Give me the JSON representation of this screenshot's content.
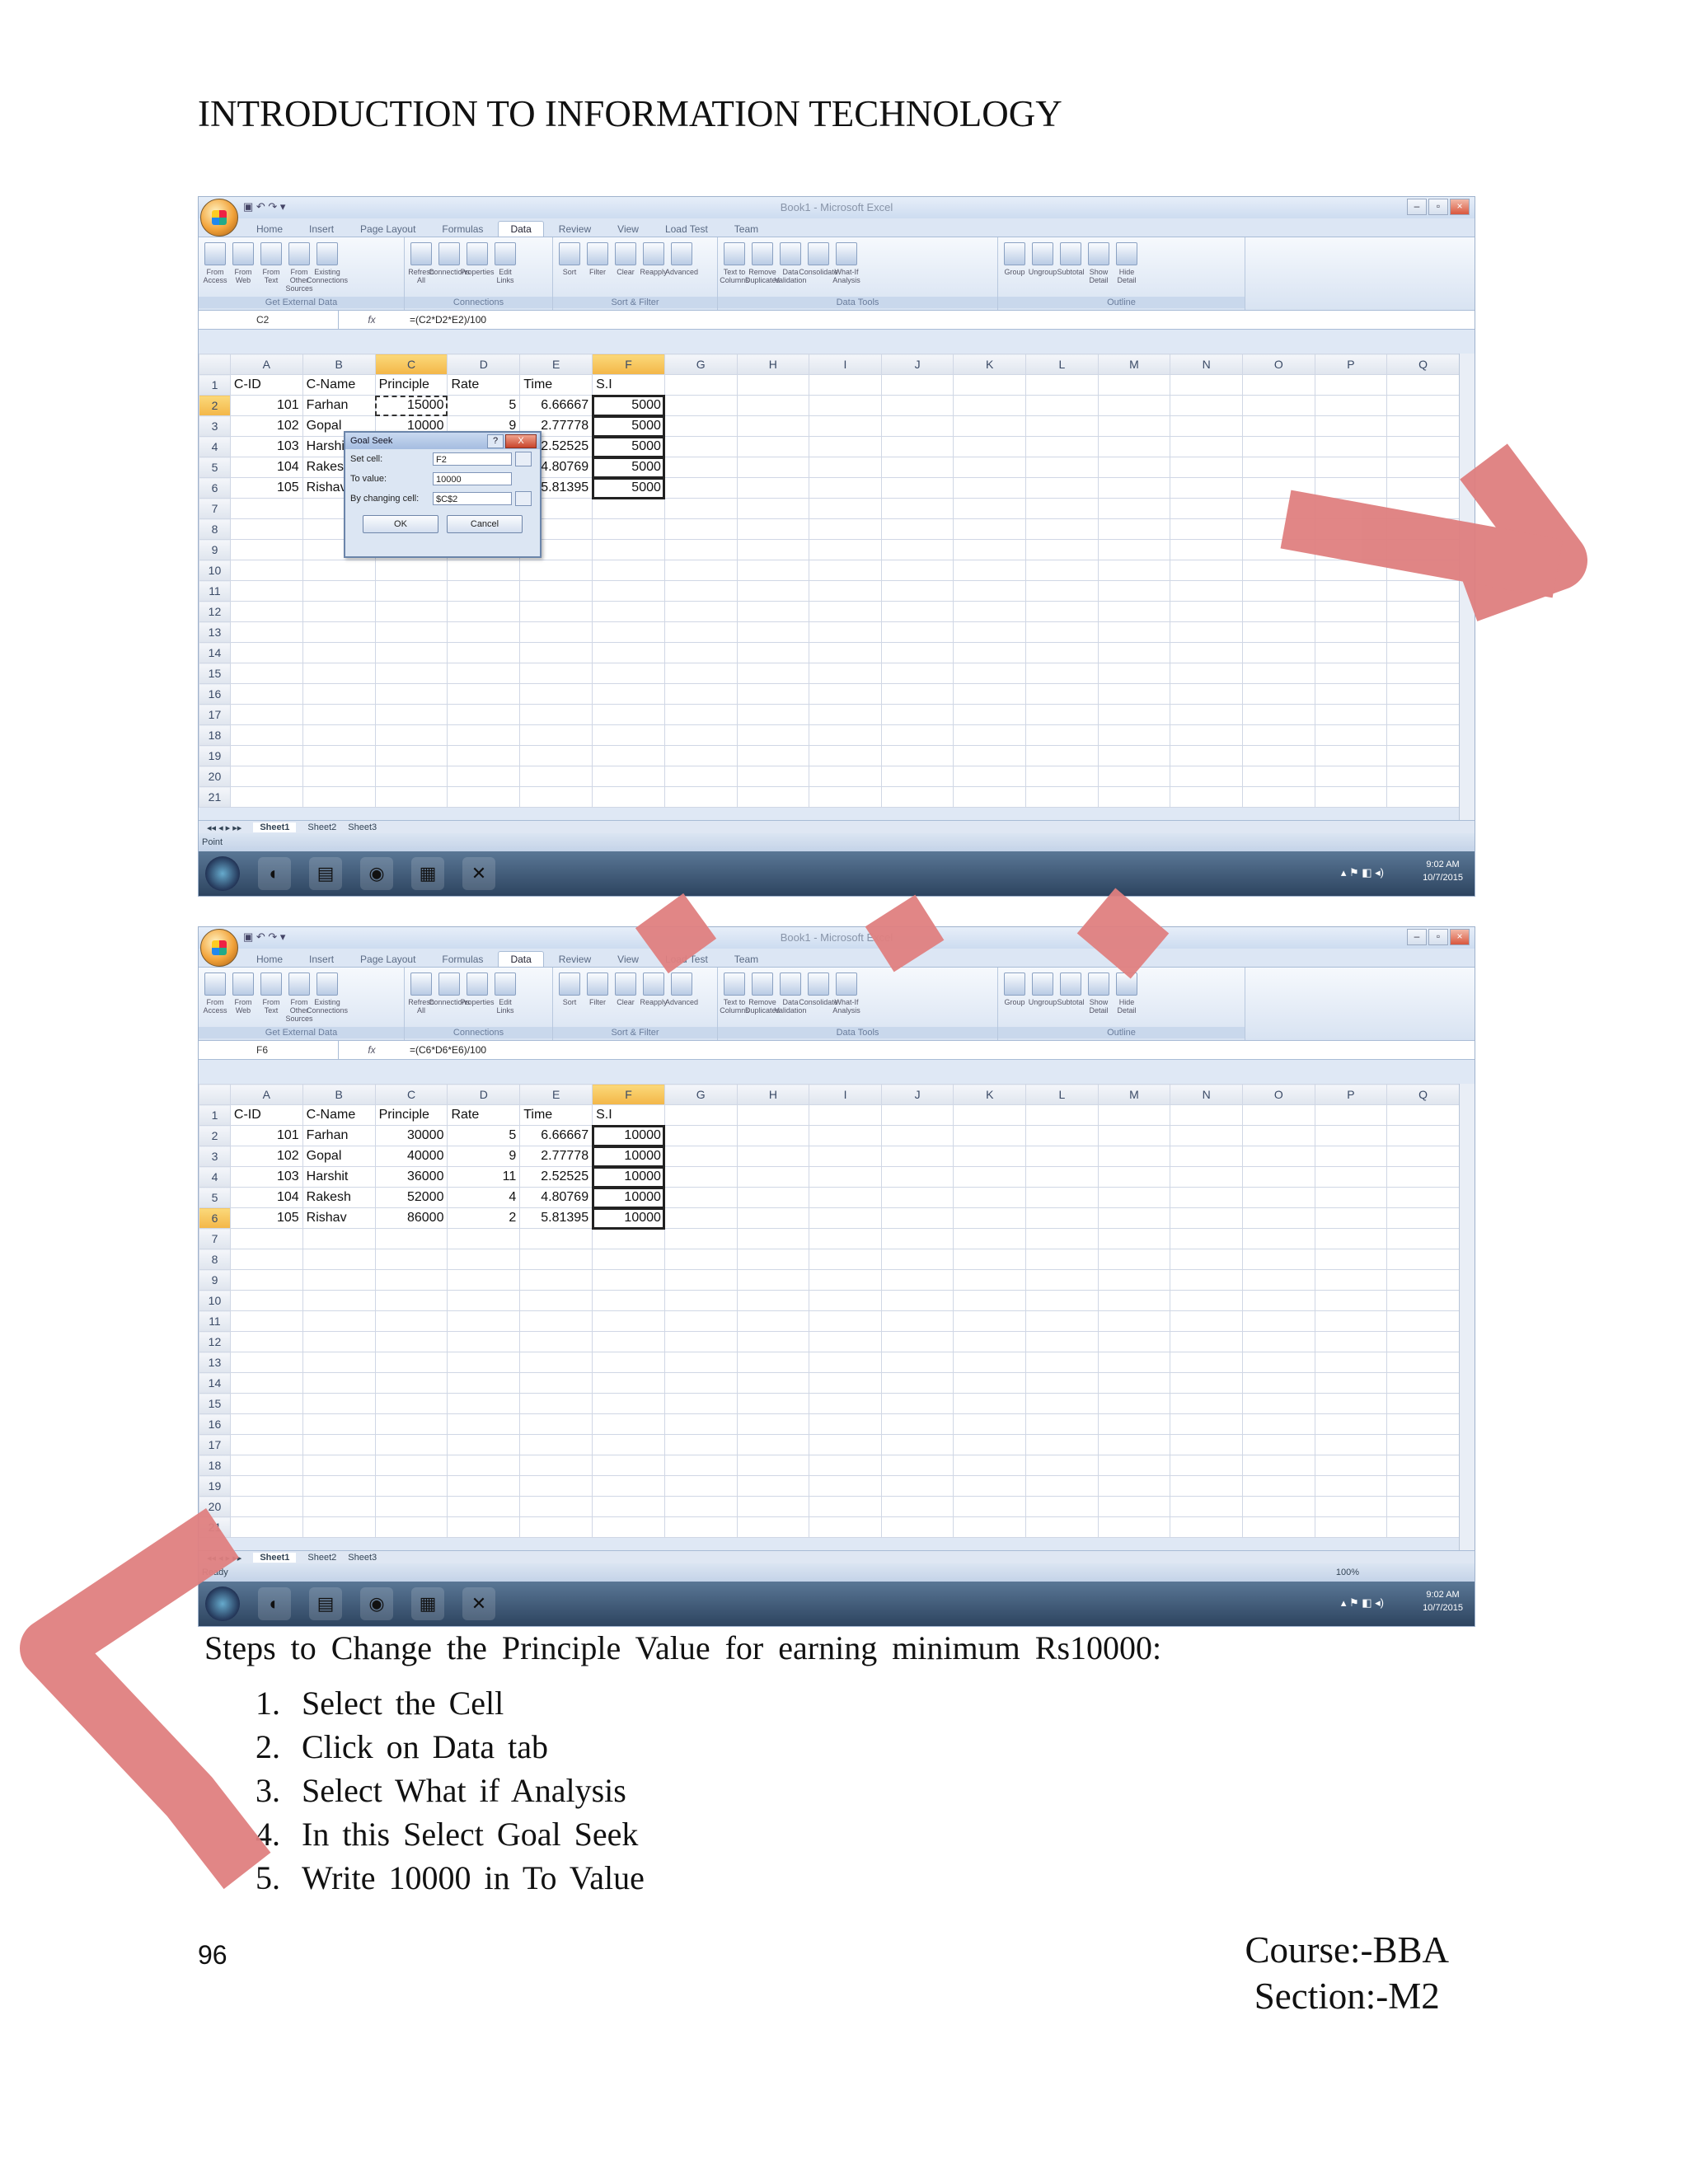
{
  "header": {
    "title": "INTRODUCTION TO INFORMATION TECHNOLOGY"
  },
  "excel": {
    "app_title": "Book1 - Microsoft Excel",
    "tabs": [
      "Home",
      "Insert",
      "Page Layout",
      "Formulas",
      "Data",
      "Review",
      "View",
      "Load Test",
      "Team"
    ],
    "active_tab": "Data",
    "ribbon_groups": [
      {
        "label": "Get External Data",
        "items": [
          "From Access",
          "From Web",
          "From Text",
          "From Other Sources",
          "Existing Connections"
        ]
      },
      {
        "label": "Connections",
        "items": [
          "Refresh All",
          "Connections",
          "Properties",
          "Edit Links"
        ]
      },
      {
        "label": "Sort & Filter",
        "items": [
          "Sort",
          "Filter",
          "Clear",
          "Reapply",
          "Advanced"
        ]
      },
      {
        "label": "Data Tools",
        "items": [
          "Text to Columns",
          "Remove Duplicates",
          "Data Validation",
          "Consolidate",
          "What-If Analysis"
        ]
      },
      {
        "label": "Outline",
        "items": [
          "Group",
          "Ungroup",
          "Subtotal",
          "Show Detail",
          "Hide Detail"
        ]
      }
    ],
    "columns": [
      "A",
      "B",
      "C",
      "D",
      "E",
      "F",
      "G",
      "H",
      "I",
      "J",
      "K",
      "L",
      "M",
      "N",
      "O",
      "P",
      "Q"
    ],
    "row_numbers": [
      "1",
      "2",
      "3",
      "4",
      "5",
      "6",
      "7",
      "8",
      "9",
      "10",
      "11",
      "12",
      "13",
      "14",
      "15",
      "16",
      "17",
      "18",
      "19",
      "20",
      "21"
    ],
    "sheet_tabs": [
      "Sheet1",
      "Sheet2",
      "Sheet3"
    ],
    "fx_label": "fx"
  },
  "screenshot1": {
    "name_box": "C2",
    "formula": "=(C2*D2*E2)/100",
    "header_row": [
      "C-ID",
      "C-Name",
      "Principle",
      "Rate",
      "Time",
      "S.I"
    ],
    "rows": [
      [
        "101",
        "Farhan",
        "15000",
        "5",
        "6.66667",
        "5000"
      ],
      [
        "102",
        "Gopal",
        "10000",
        "9",
        "2.77778",
        "5000"
      ],
      [
        "103",
        "Harshit",
        "",
        "",
        "2.52525",
        "5000"
      ],
      [
        "104",
        "Rakesh",
        "",
        "",
        "4.80769",
        "5000"
      ],
      [
        "105",
        "Rishav",
        "",
        "",
        "5.81395",
        "5000"
      ]
    ],
    "status": "Point",
    "dialog": {
      "title": "Goal Seek",
      "help": "?",
      "close": "X",
      "set_cell_label": "Set cell:",
      "set_cell_value": "F2",
      "to_value_label": "To value:",
      "to_value_value": "10000",
      "changing_label": "By changing cell:",
      "changing_value": "$C$2",
      "ok": "OK",
      "cancel": "Cancel"
    },
    "clock": [
      "9:02 AM",
      "10/7/2015"
    ]
  },
  "screenshot2": {
    "name_box": "F6",
    "formula": "=(C6*D6*E6)/100",
    "header_row": [
      "C-ID",
      "C-Name",
      "Principle",
      "Rate",
      "Time",
      "S.I"
    ],
    "rows": [
      [
        "101",
        "Farhan",
        "30000",
        "5",
        "6.66667",
        "10000"
      ],
      [
        "102",
        "Gopal",
        "40000",
        "9",
        "2.77778",
        "10000"
      ],
      [
        "103",
        "Harshit",
        "36000",
        "11",
        "2.52525",
        "10000"
      ],
      [
        "104",
        "Rakesh",
        "52000",
        "4",
        "4.80769",
        "10000"
      ],
      [
        "105",
        "Rishav",
        "86000",
        "2",
        "5.81395",
        "10000"
      ]
    ],
    "status": "Ready",
    "zoom": "100%",
    "clock": [
      "9:02 AM",
      "10/7/2015"
    ]
  },
  "steps": {
    "title": "Steps to Change the Principle Value for earning minimum Rs10000:",
    "items": [
      "Select the Cell",
      "Click on Data tab",
      "Select What if Analysis",
      "In this Select Goal Seek",
      "Write 10000 in To Value"
    ]
  },
  "footer": {
    "page_number": "96",
    "course": "Course:-BBA",
    "section": "Section:-M2"
  },
  "colors": {
    "watermark": "#df7f7f",
    "ribbon": "#dfe8f5",
    "selected_header": "#f3b648"
  }
}
